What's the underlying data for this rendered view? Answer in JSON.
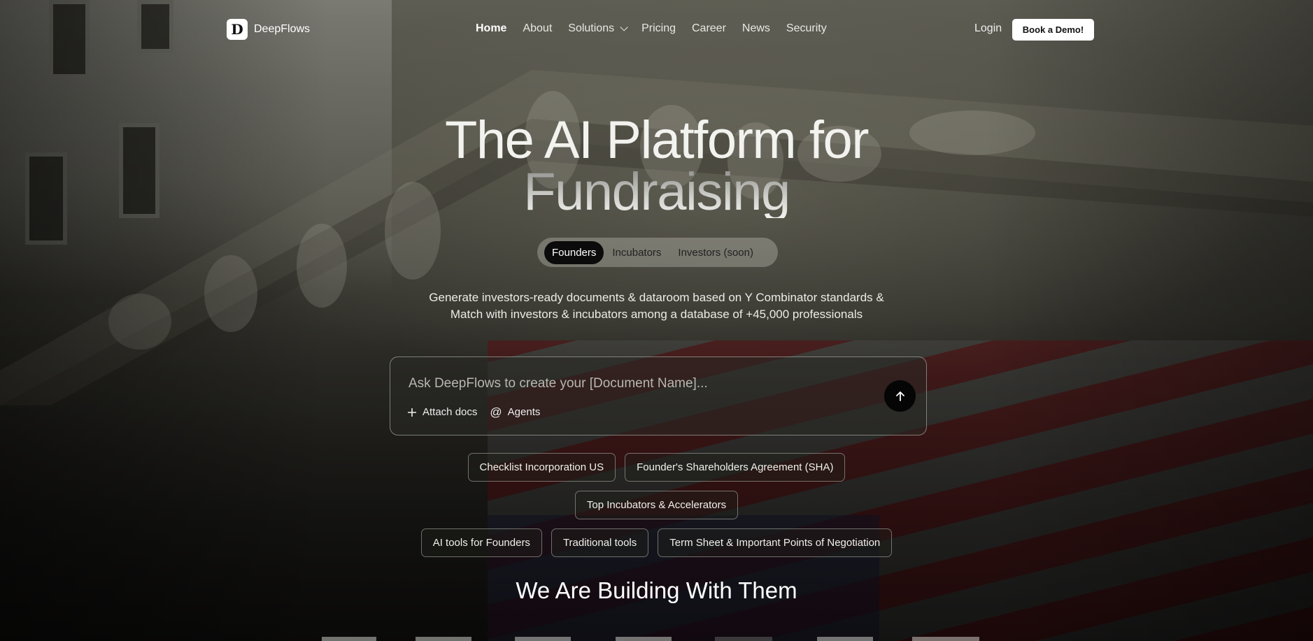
{
  "brand": {
    "name": "DeepFlows",
    "logo_letter": "D"
  },
  "nav": {
    "items": [
      {
        "label": "Home",
        "active": true
      },
      {
        "label": "About"
      },
      {
        "label": "Solutions",
        "dropdown": true
      },
      {
        "label": "Pricing"
      },
      {
        "label": "Career"
      },
      {
        "label": "News"
      },
      {
        "label": "Security"
      }
    ],
    "login": "Login",
    "cta": "Book a Demo!"
  },
  "hero": {
    "title_line1": "The AI Platform for",
    "title_line2": "Fundraising",
    "segments": [
      "Founders",
      "Incubators",
      "Investors (soon)"
    ],
    "active_segment": "Founders",
    "subtitle_line1": "Generate investors-ready documents & dataroom based on Y Combinator standards &",
    "subtitle_line2": "Match with investors & incubators among a database of +45,000 professionals"
  },
  "prompt": {
    "placeholder": "Ask DeepFlows to create your [Document Name]...",
    "attach_label": "Attach docs",
    "agents_label": "Agents",
    "icons": {
      "attach": "plus-icon",
      "agents": "at-icon",
      "send": "arrow-up-icon"
    }
  },
  "chips": {
    "row1": [
      "Checklist Incorporation US",
      "Founder's Shareholders Agreement (SHA)"
    ],
    "row2": [
      "Top Incubators & Accelerators"
    ],
    "row3": [
      "AI tools for Founders",
      "Traditional tools",
      "Term Sheet & Important Points of Negotiation"
    ]
  },
  "partners": {
    "title": "We Are Building With Them"
  },
  "colors": {
    "cta_bg": "#ffffff",
    "active_segment_bg": "#0b0b0b",
    "send_bg": "#050505"
  }
}
